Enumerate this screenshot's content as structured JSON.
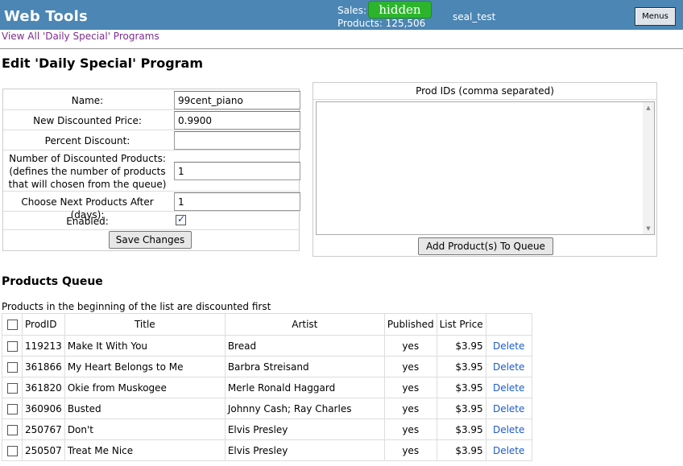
{
  "header": {
    "app_title": "Web Tools",
    "sales_label": "Sales:",
    "sales_value": "hidden",
    "products_count": "Products: 125,506",
    "user": "seal_test",
    "menus_label": "Menus"
  },
  "nav": {
    "back_link": "View All 'Daily Special' Programs"
  },
  "page_title": "Edit 'Daily Special' Program",
  "form": {
    "name_label": "Name:",
    "name_value": "99cent_piano",
    "price_label": "New Discounted Price:",
    "price_value": "0.9900",
    "percent_label": "Percent Discount:",
    "percent_value": "",
    "num_label_1": "Number of Discounted Products:",
    "num_label_2": "(defines the number of products",
    "num_label_3": "that will chosen from the queue)",
    "num_value": "1",
    "days_label": "Choose Next Products After (days):",
    "days_value": "1",
    "enabled_label": "Enabled:",
    "enabled": true,
    "save_label": "Save Changes"
  },
  "prod_ids": {
    "heading": "Prod IDs (comma separated)",
    "value": "",
    "add_label": "Add Product(s) To Queue"
  },
  "queue": {
    "title": "Products Queue",
    "note": "Products in the beginning of the list are discounted first",
    "columns": [
      "ProdID",
      "Title",
      "Artist",
      "Published",
      "List Price"
    ],
    "delete_label": "Delete",
    "rows": [
      {
        "id": "119213",
        "title": "Make It With You",
        "artist": "Bread",
        "published": "yes",
        "price": "$3.95"
      },
      {
        "id": "361866",
        "title": "My Heart Belongs to Me",
        "artist": "Barbra Streisand",
        "published": "yes",
        "price": "$3.95"
      },
      {
        "id": "361820",
        "title": "Okie from Muskogee",
        "artist": "Merle Ronald Haggard",
        "published": "yes",
        "price": "$3.95"
      },
      {
        "id": "360906",
        "title": "Busted",
        "artist": "Johnny Cash; Ray Charles",
        "published": "yes",
        "price": "$3.95"
      },
      {
        "id": "250767",
        "title": "Don't",
        "artist": "Elvis Presley",
        "published": "yes",
        "price": "$3.95"
      },
      {
        "id": "250507",
        "title": "Treat Me Nice",
        "artist": "Elvis Presley",
        "published": "yes",
        "price": "$3.95"
      }
    ]
  },
  "colors": {
    "header_bg": "#4b86b4",
    "hidden_badge": "#2cb52c",
    "link_visited": "#7b2d8e",
    "link": "#1b5cc7"
  }
}
